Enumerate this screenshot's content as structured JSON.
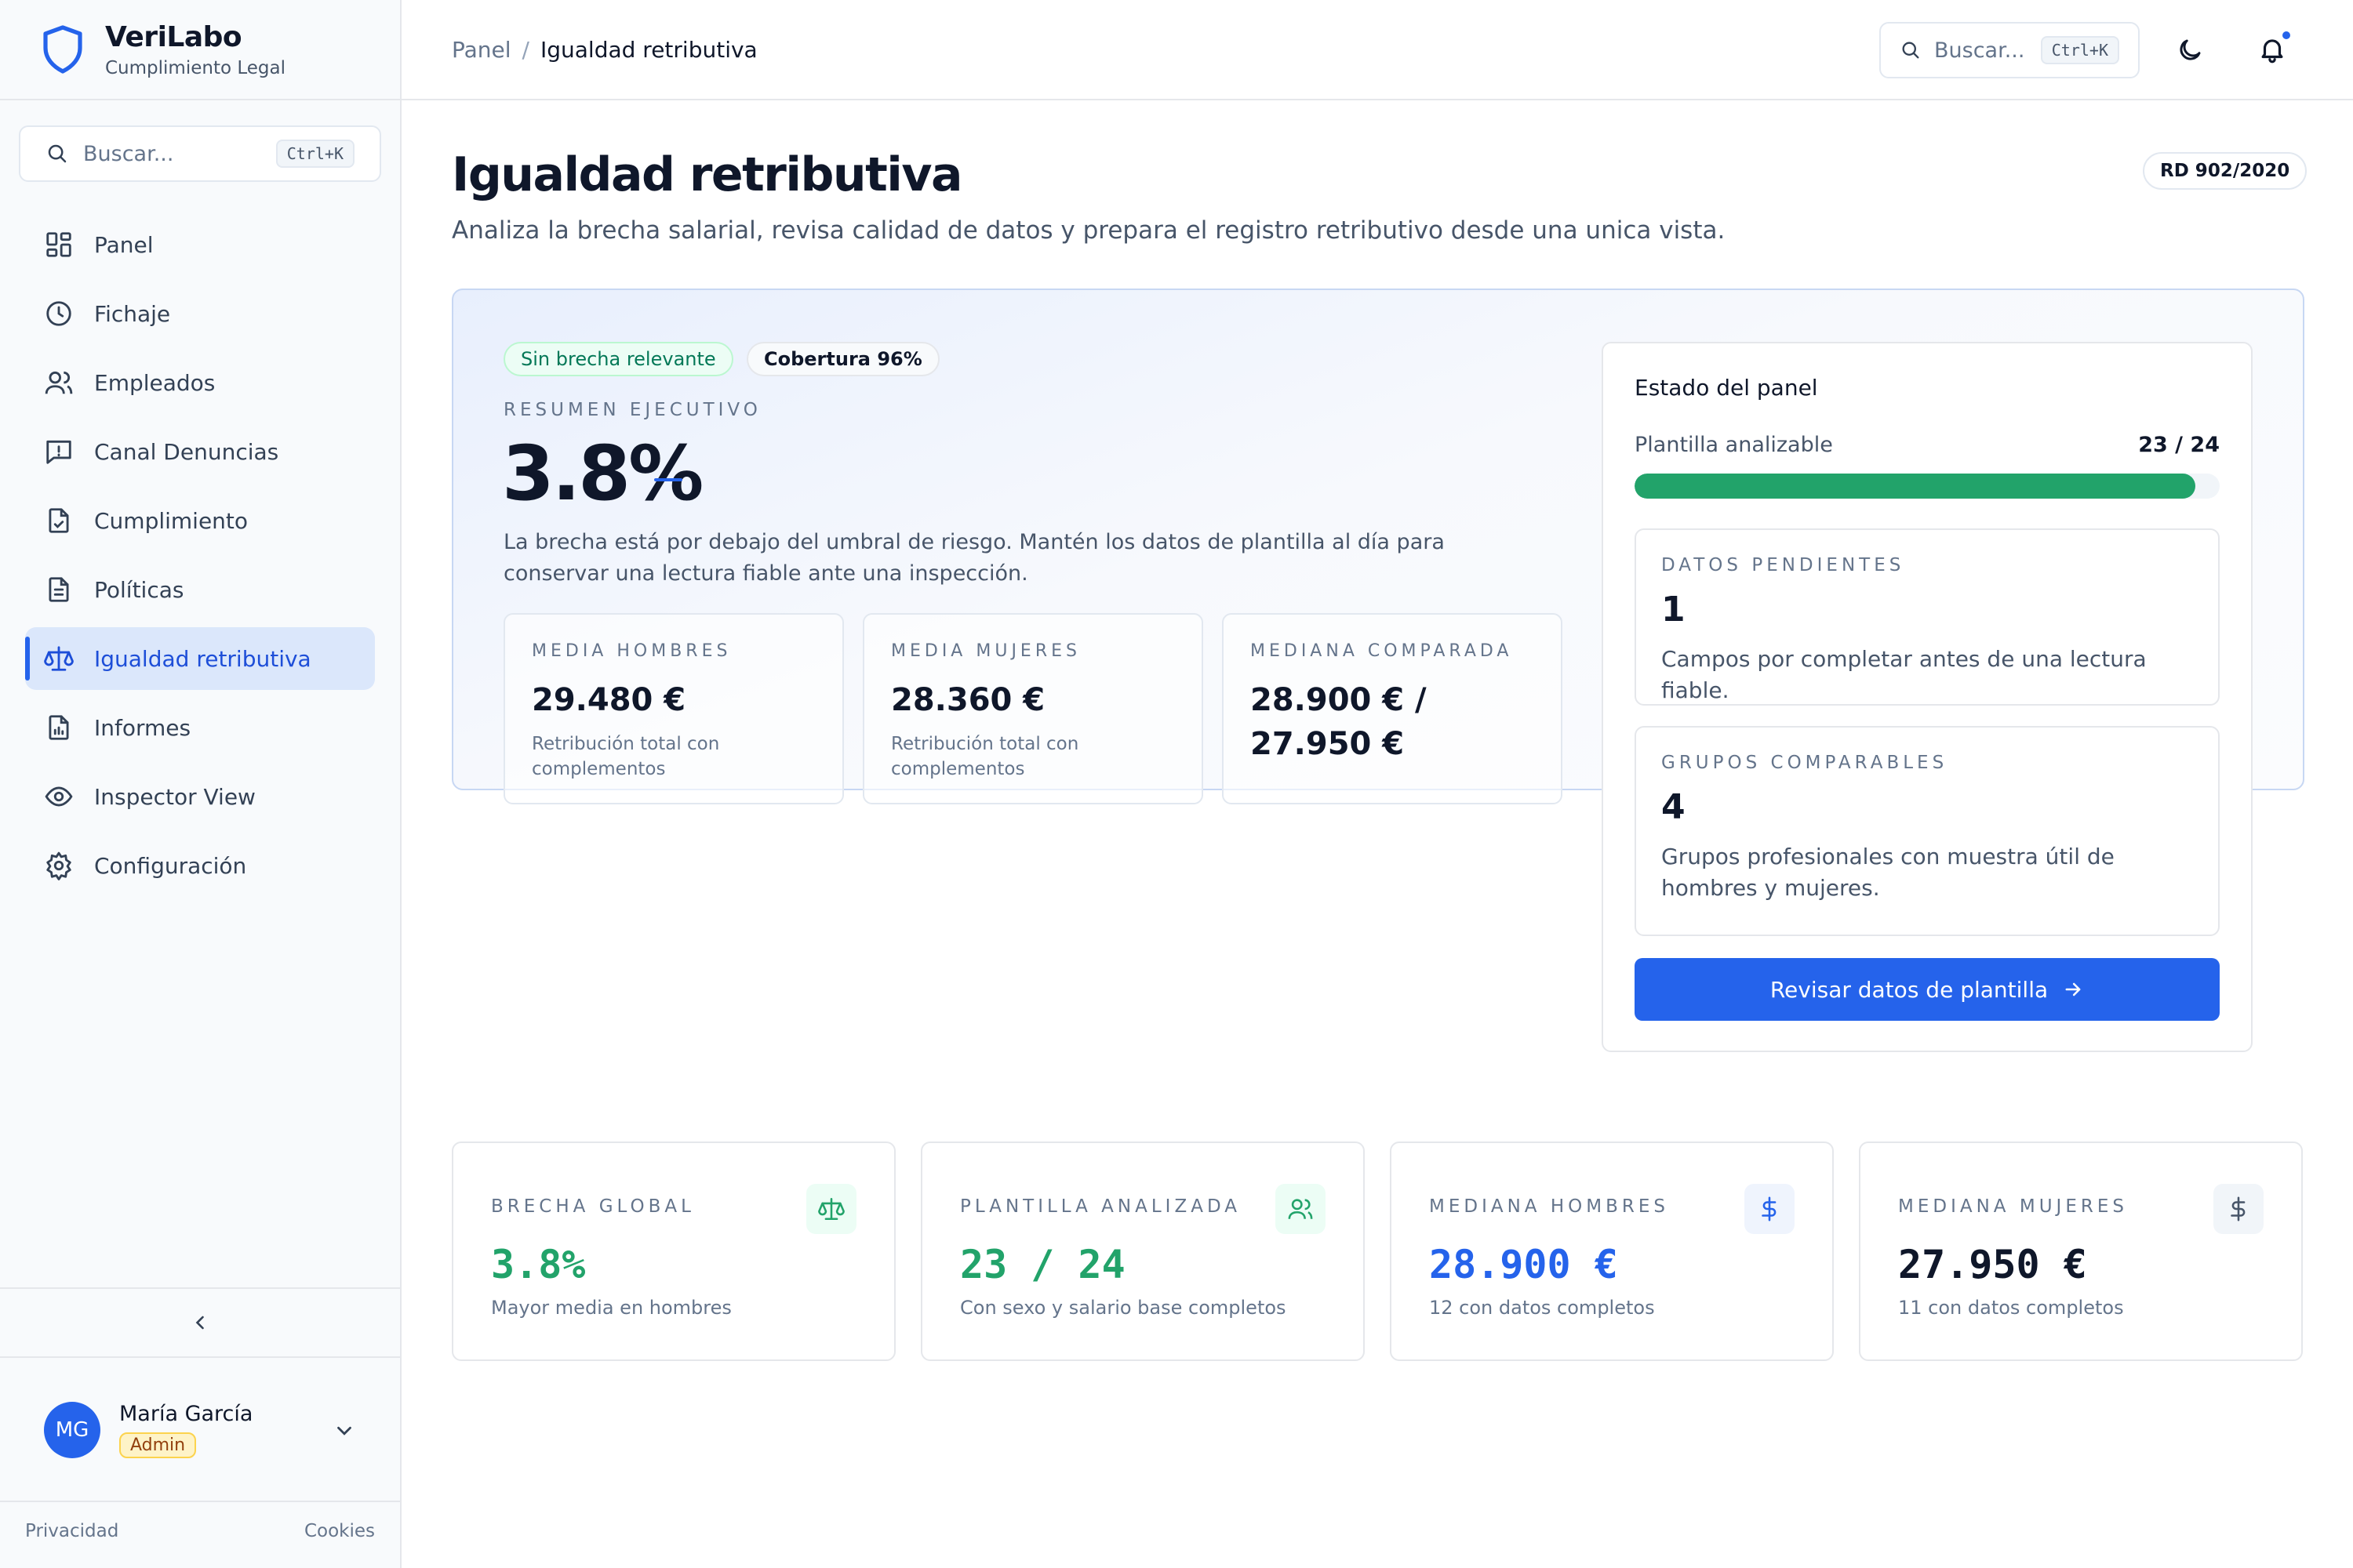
{
  "brand": {
    "name": "VeriLabo",
    "subtitle": "Cumplimiento Legal"
  },
  "sidebar": {
    "search_placeholder": "Buscar...",
    "search_shortcut": "Ctrl+K",
    "items": [
      {
        "label": "Panel",
        "icon": "grid-icon"
      },
      {
        "label": "Fichaje",
        "icon": "clock-icon"
      },
      {
        "label": "Empleados",
        "icon": "users-icon"
      },
      {
        "label": "Canal Denuncias",
        "icon": "message-alert-icon"
      },
      {
        "label": "Cumplimiento",
        "icon": "file-check-icon"
      },
      {
        "label": "Políticas",
        "icon": "file-text-icon"
      },
      {
        "label": "Igualdad retributiva",
        "icon": "scale-icon",
        "active": true
      },
      {
        "label": "Informes",
        "icon": "file-chart-icon"
      },
      {
        "label": "Inspector View",
        "icon": "eye-icon"
      },
      {
        "label": "Configuración",
        "icon": "gear-icon"
      }
    ],
    "user": {
      "initials": "MG",
      "name": "María García",
      "role": "Admin"
    },
    "footer": {
      "privacy": "Privacidad",
      "cookies": "Cookies"
    }
  },
  "topbar": {
    "breadcrumb": {
      "root": "Panel",
      "separator": "/",
      "current": "Igualdad retributiva"
    },
    "search_placeholder": "Buscar...",
    "search_shortcut": "Ctrl+K"
  },
  "page": {
    "title": "Igualdad retributiva",
    "subtitle": "Analiza la brecha salarial, revisa calidad de datos y prepara el registro retributivo desde una unica vista.",
    "badge": "RD 902/2020"
  },
  "hero": {
    "pill_status": "Sin brecha relevante",
    "pill_coverage": "Cobertura 96%",
    "eyebrow": "RESUMEN EJECUTIVO",
    "value": "3.8%",
    "description": "La brecha está por debajo del umbral de riesgo. Mantén los datos de plantilla al día para conservar una lectura fiable ante una inspección.",
    "mini": [
      {
        "label": "MEDIA HOMBRES",
        "value": "29.480 €",
        "desc": "Retribución total con complementos"
      },
      {
        "label": "MEDIA MUJERES",
        "value": "28.360 €",
        "desc": "Retribución total con complementos"
      },
      {
        "label": "MEDIANA COMPARADA",
        "value": "28.900 € / 27.950 €",
        "desc": ""
      }
    ]
  },
  "state": {
    "title": "Estado del panel",
    "row_label": "Plantilla analizable",
    "row_value": "23 / 24",
    "progress_fraction": 0.958,
    "pending": {
      "label": "DATOS PENDIENTES",
      "value": "1",
      "desc": "Campos por completar antes de una lectura fiable."
    },
    "groups": {
      "label": "GRUPOS COMPARABLES",
      "value": "4",
      "desc": "Grupos profesionales con muestra útil de hombres y mujeres."
    },
    "button": "Revisar datos de plantilla"
  },
  "kpis": [
    {
      "label": "BRECHA GLOBAL",
      "value": "3.8%",
      "desc": "Mayor media en hombres",
      "icon": "scale-icon",
      "color": "#22a36a",
      "icon_bg": "#ecfdf5"
    },
    {
      "label": "PLANTILLA ANALIZADA",
      "value": "23 / 24",
      "desc": "Con sexo y salario base completos",
      "icon": "users-icon",
      "color": "#22a36a",
      "icon_bg": "#ecfdf5"
    },
    {
      "label": "MEDIANA HOMBRES",
      "value": "28.900 €",
      "desc": "12 con datos completos",
      "icon": "dollar-icon",
      "color": "#2563eb",
      "icon_bg": "#eff4fd"
    },
    {
      "label": "MEDIANA MUJERES",
      "value": "27.950 €",
      "desc": "11 con datos completos",
      "icon": "dollar-icon",
      "color": "#0f172a",
      "icon_bg": "#f1f5f9"
    }
  ],
  "colors": {
    "accent": "#2563eb",
    "success": "#22a36a"
  }
}
